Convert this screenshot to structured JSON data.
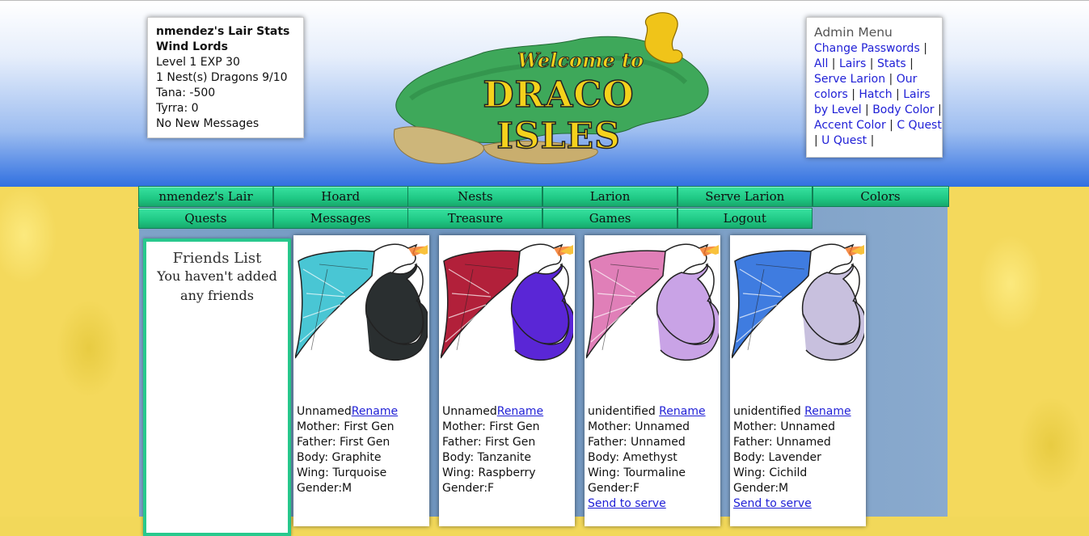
{
  "stats": {
    "title": "nmendez's Lair Stats",
    "faction": "Wind Lords",
    "level": "Level 1 EXP 30",
    "nests": "1 Nest(s) Dragons 9/10",
    "tana": "Tana: -500",
    "tyrra": "Tyrra: 0",
    "messages": "No New Messages"
  },
  "logo": {
    "line1": "Welcome to",
    "line2": "DRACO ISLES"
  },
  "admin": {
    "heading": "Admin Menu",
    "links": [
      "Change Passwords",
      "All",
      "Lairs",
      "Stats",
      "Serve Larion",
      "Our colors",
      "Hatch",
      "Lairs by Level",
      "Body Color",
      "Accent Color",
      "C Quest",
      "U Quest"
    ],
    "separator": "|"
  },
  "nav": {
    "row1": [
      "nmendez's Lair",
      "Hoard",
      "Nests",
      "Larion",
      "Serve Larion",
      "Colors"
    ],
    "row2": [
      "Quests",
      "Messages",
      "Treasure",
      "Games",
      "Logout"
    ]
  },
  "friends": {
    "title": "Friends List",
    "empty": "You haven't added any friends"
  },
  "dragons": [
    {
      "name": "Unnamed",
      "rename": "Rename",
      "mother": "Mother: First Gen",
      "father": "Father: First Gen",
      "body": "Body: Graphite",
      "wing": "Wing: Turquoise",
      "gender": "Gender:M",
      "serve": "",
      "body_color": "#2a2f30",
      "wing_color": "#49c6d4"
    },
    {
      "name": "Unnamed",
      "rename": "Rename",
      "mother": "Mother: First Gen",
      "father": "Father: First Gen",
      "body": "Body: Tanzanite",
      "wing": "Wing: Raspberry",
      "gender": "Gender:F",
      "serve": "",
      "body_color": "#5a26d6",
      "wing_color": "#b2203a"
    },
    {
      "name": "unidentified ",
      "rename": "Rename",
      "mother": "Mother: Unnamed",
      "father": "Father: Unnamed",
      "body": "Body: Amethyst",
      "wing": "Wing: Tourmaline",
      "gender": "Gender:F",
      "serve": "Send to serve",
      "body_color": "#c9a3e6",
      "wing_color": "#e07fb8"
    },
    {
      "name": "unidentified ",
      "rename": "Rename",
      "mother": "Mother: Unnamed",
      "father": "Father: Unnamed",
      "body": "Body: Lavender",
      "wing": "Wing: Cichild",
      "gender": "Gender:M",
      "serve": "Send to serve",
      "body_color": "#c8c0de",
      "wing_color": "#3f7ce0"
    }
  ]
}
